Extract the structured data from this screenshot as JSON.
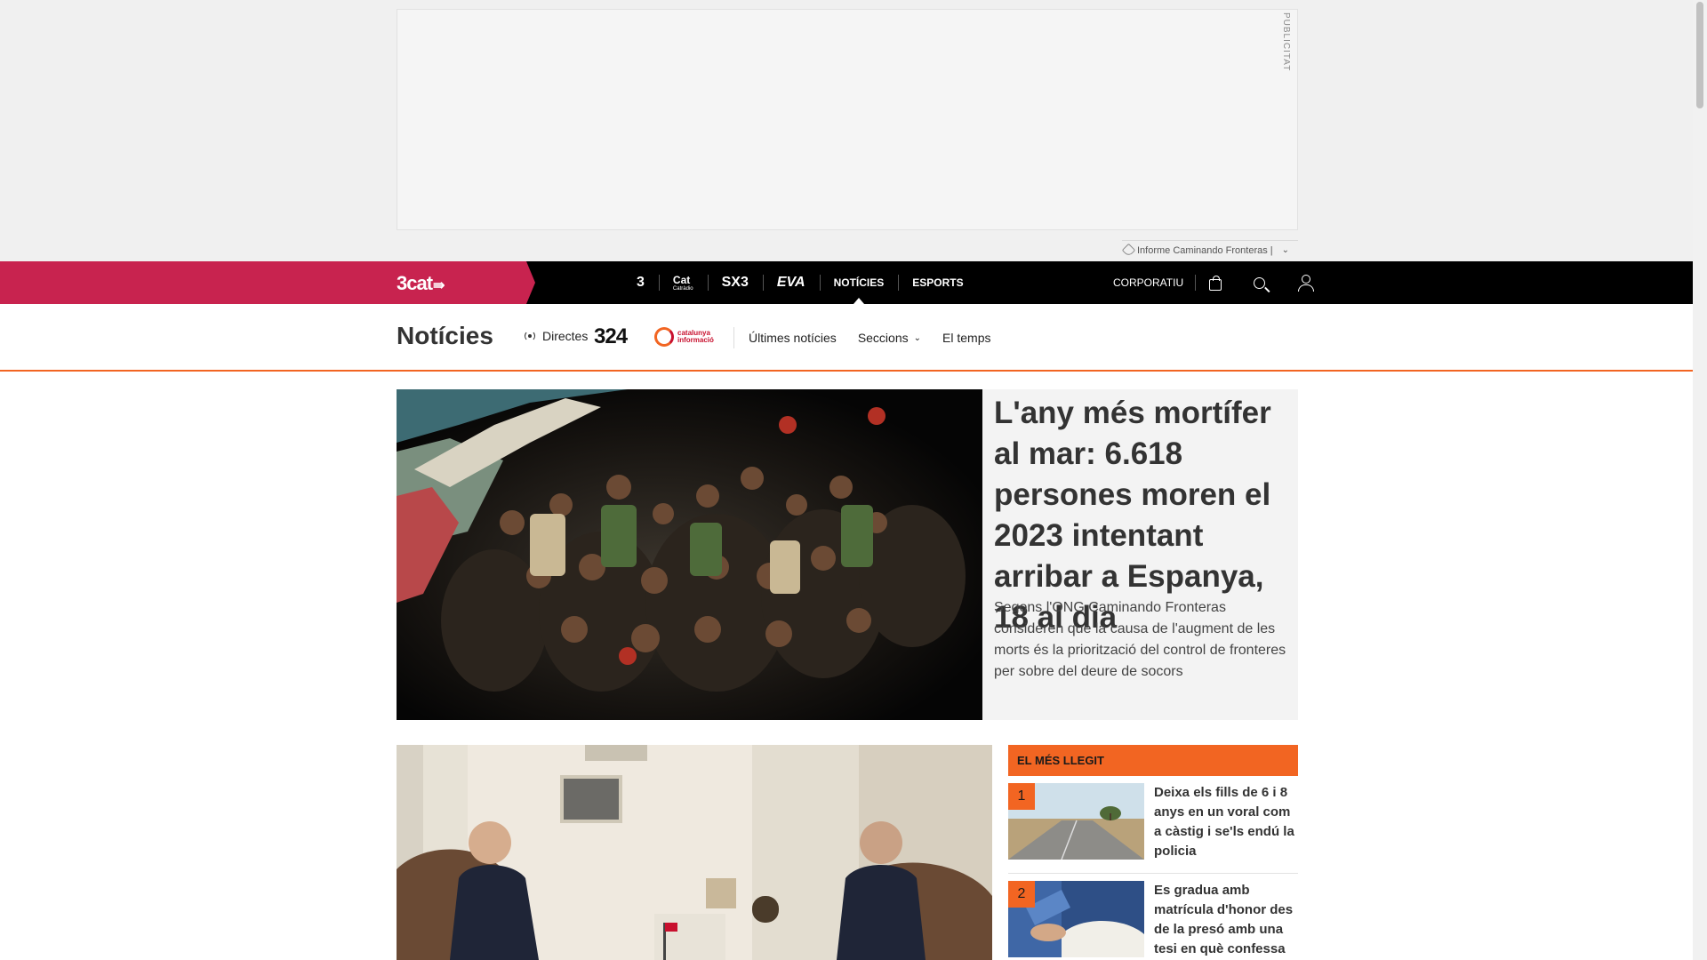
{
  "ad": {
    "label": "PUBLICITAT",
    "report_text": "Informe Caminando Fronteras |"
  },
  "topnav": {
    "brand": "3cat",
    "channels": [
      {
        "label": "3",
        "icon": "tv3-logo-icon"
      },
      {
        "label": "Cat",
        "sub": "Catràdio",
        "icon": "catradio-logo-icon"
      },
      {
        "label": "SX3",
        "icon": "sx3-logo-icon"
      },
      {
        "label": "EVA",
        "icon": "eva-logo-icon"
      },
      {
        "label": "NOTÍCIES"
      },
      {
        "label": "ESPORTS"
      }
    ],
    "corporatiu": "CORPORATIU"
  },
  "section": {
    "title": "Notícies",
    "directes": "Directes",
    "logo_324": "324",
    "logo_catinfo": "catalunya informació",
    "links": [
      "Últimes notícies",
      "Seccions",
      "El temps"
    ]
  },
  "hero": {
    "title": "L'any més mortífer al mar: 6.618 persones moren el 2023 intentant arribar a Espanya, 18 al dia",
    "subtitle": "Segons l'ONG Caminando Fronteras consideren que la causa de l'augment de les morts és la priorització del control de fronteres per sobre del deure de socors"
  },
  "most_read": {
    "heading": "EL MÉS LLEGIT",
    "items": [
      {
        "num": "1",
        "title": "Deixa els fills de 6 i 8 anys en un voral com a càstig i se'ls endú la policia"
      },
      {
        "num": "2",
        "title": "Es gradua amb matrícula d'honor des de la presó amb una tesi en què confessa"
      }
    ]
  },
  "colors": {
    "brand": "#c8234f",
    "accent": "#f26522",
    "nav_bg": "#000000"
  }
}
